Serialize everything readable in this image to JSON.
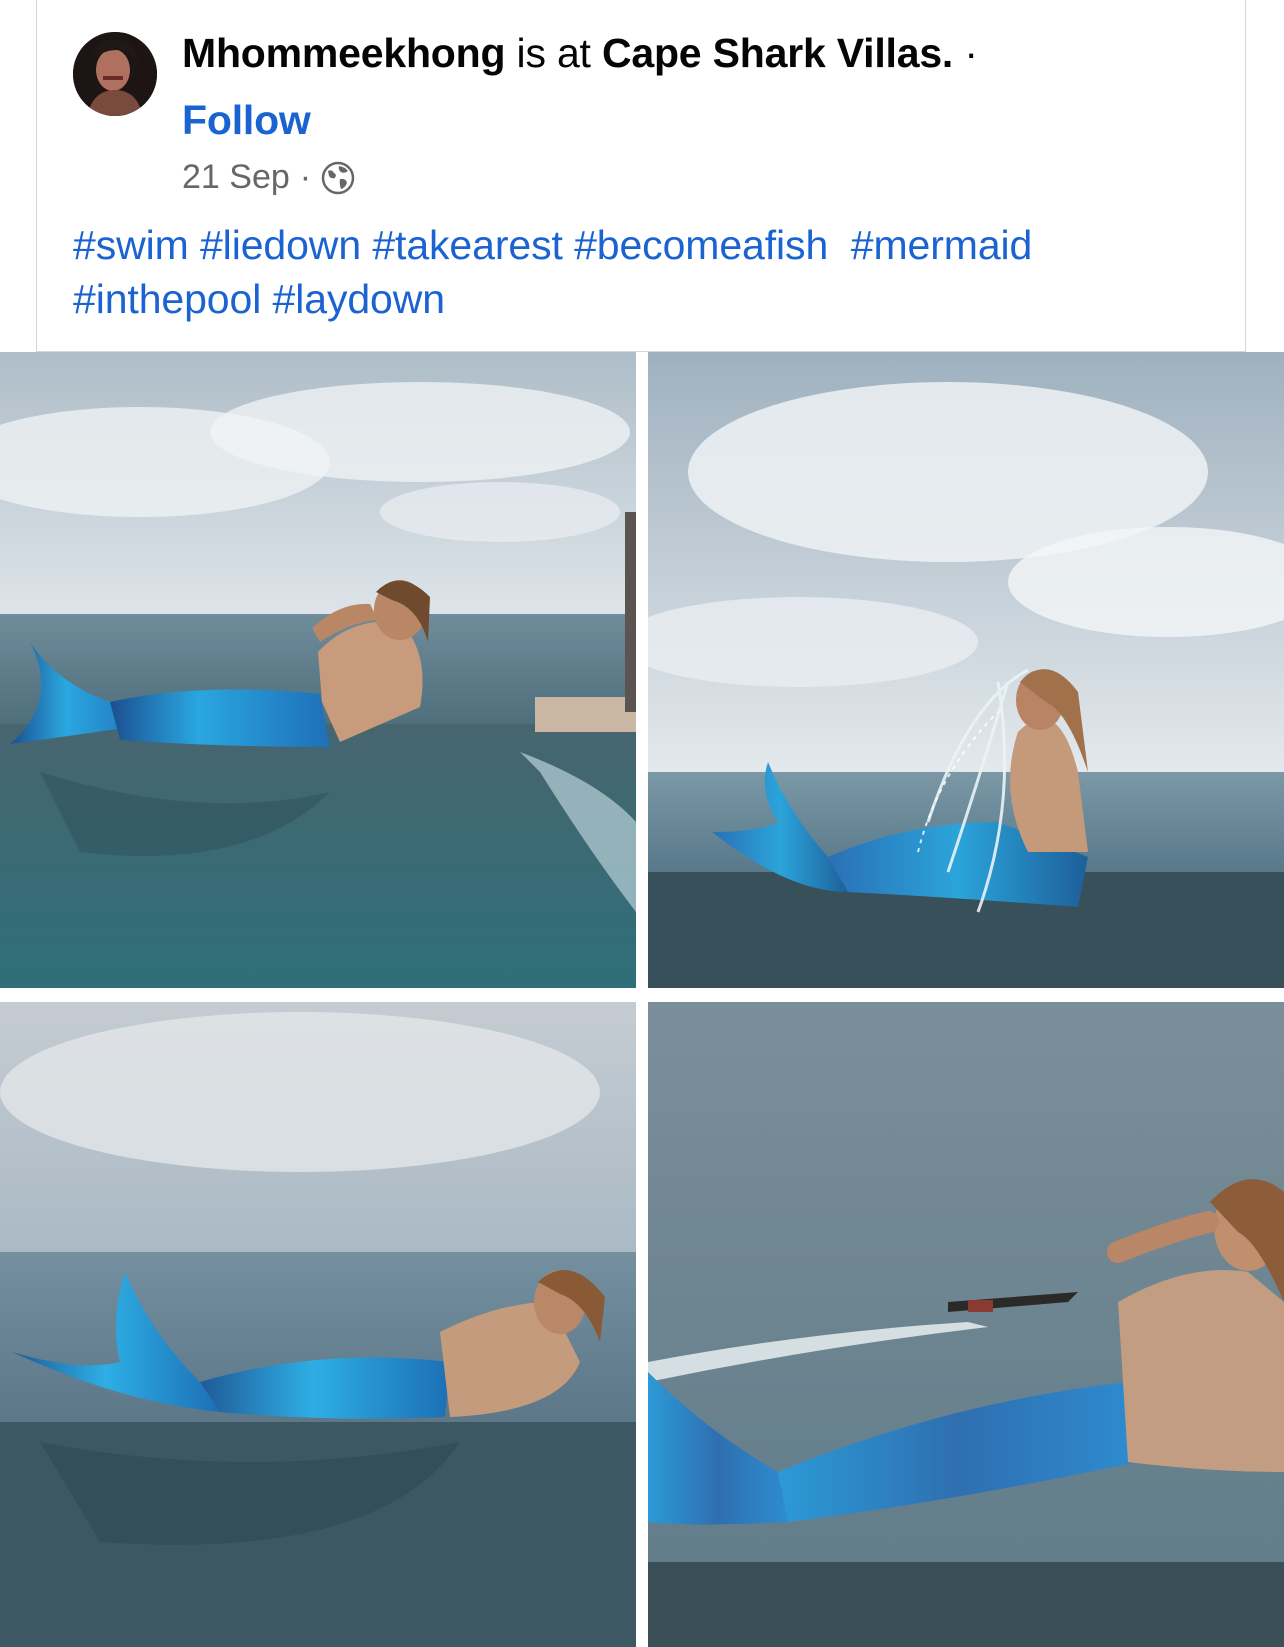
{
  "post": {
    "author": "Mhommeekhong",
    "at_text": "is at",
    "place": "Cape Shark Villas.",
    "dot": "·",
    "follow_label": "Follow",
    "date": "21 Sep",
    "meta_dot": "·",
    "privacy_icon": "globe-icon",
    "hashtags": [
      "#swim",
      "#liedown",
      "#takearest",
      "#becomeafish",
      "#mermaid",
      "#inthepool",
      "#laydown"
    ]
  },
  "photos": [
    {
      "name": "photo-mermaid-lying-pool-edge"
    },
    {
      "name": "photo-mermaid-water-splash"
    },
    {
      "name": "photo-mermaid-reclining-sea"
    },
    {
      "name": "photo-mermaid-closeup-boat"
    }
  ],
  "colors": {
    "link": "#1b63d0",
    "text": "#050505",
    "meta": "#65676b",
    "tail_blue": "#1f8fd6",
    "sea": "#5d7f8e",
    "sky": "#c9d3db"
  }
}
